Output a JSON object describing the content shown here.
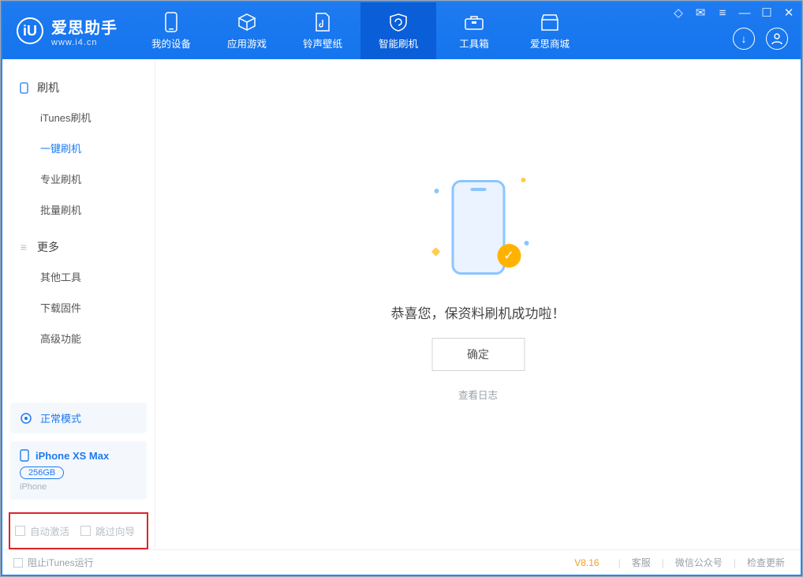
{
  "app": {
    "name": "爱思助手",
    "domain": "www.i4.cn"
  },
  "tabs": {
    "device": "我的设备",
    "apps": "应用游戏",
    "ring": "铃声壁纸",
    "flash": "智能刷机",
    "tools": "工具箱",
    "shop": "爱思商城"
  },
  "sidebar": {
    "section_flash": "刷机",
    "items_flash": [
      "iTunes刷机",
      "一键刷机",
      "专业刷机",
      "批量刷机"
    ],
    "section_more": "更多",
    "items_more": [
      "其他工具",
      "下载固件",
      "高级功能"
    ],
    "mode": "正常模式",
    "device_name": "iPhone XS Max",
    "device_cap": "256GB",
    "device_type": "iPhone",
    "auto_activate": "自动激活",
    "skip_wizard": "跳过向导"
  },
  "main": {
    "message": "恭喜您，保资料刷机成功啦！",
    "ok": "确定",
    "log": "查看日志"
  },
  "footer": {
    "block_itunes": "阻止iTunes运行",
    "version": "V8.16",
    "service": "客服",
    "wechat": "微信公众号",
    "update": "检查更新"
  }
}
